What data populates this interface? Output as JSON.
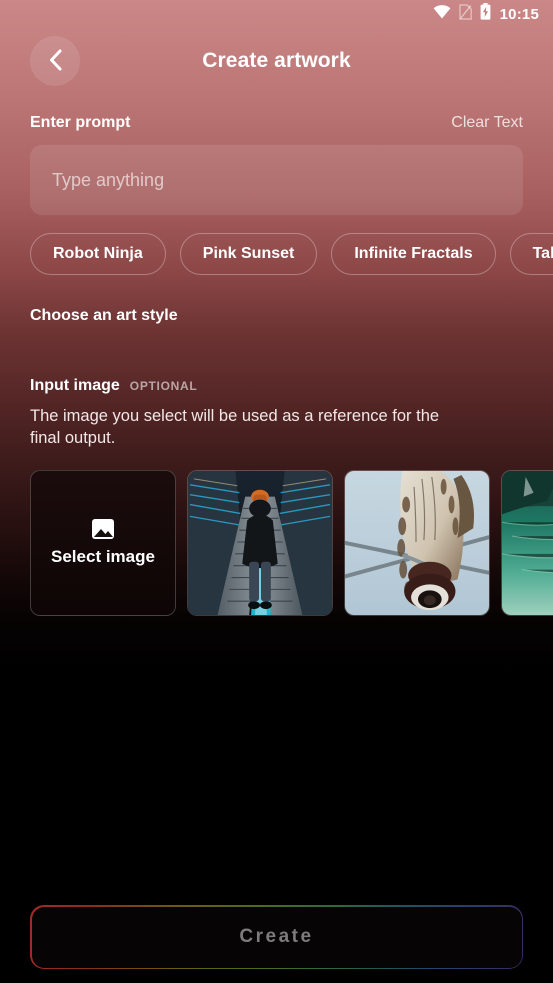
{
  "status_bar": {
    "time": "10:15",
    "icons": [
      "wifi-icon",
      "no-sim-icon",
      "battery-charging-icon"
    ]
  },
  "header": {
    "back_icon": "chevron-left-icon",
    "title": "Create artwork"
  },
  "prompt_section": {
    "label": "Enter prompt",
    "clear_label": "Clear Text",
    "input_value": "",
    "input_placeholder": "Type anything",
    "chips": [
      {
        "label": "Robot Ninja"
      },
      {
        "label": "Pink Sunset"
      },
      {
        "label": "Infinite Fractals"
      },
      {
        "label": "Tall Bird"
      }
    ]
  },
  "art_style_section": {
    "label": "Choose an art style"
  },
  "input_image_section": {
    "label": "Input image",
    "badge": "OPTIONAL",
    "description": "The image you select will be used as a reference for the final output.",
    "select_card": {
      "icon": "image-picture-icon",
      "label": "Select image"
    },
    "thumbnails": [
      {
        "name": "escalator-figure-photo",
        "alt": "Hooded person on escalator with blue neon lighting"
      },
      {
        "name": "bird-powerline-photo",
        "alt": "Bird perched on a power line insulator"
      },
      {
        "name": "lake-boat-photo",
        "alt": "Wooden boat on a turquoise mountain lake"
      }
    ]
  },
  "create_button": {
    "label": "Create",
    "enabled": false
  },
  "colors": {
    "background_top": "#cb8787",
    "background_bottom": "#000000",
    "text_primary": "#ffffff",
    "create_label": "#7c7c7c"
  }
}
